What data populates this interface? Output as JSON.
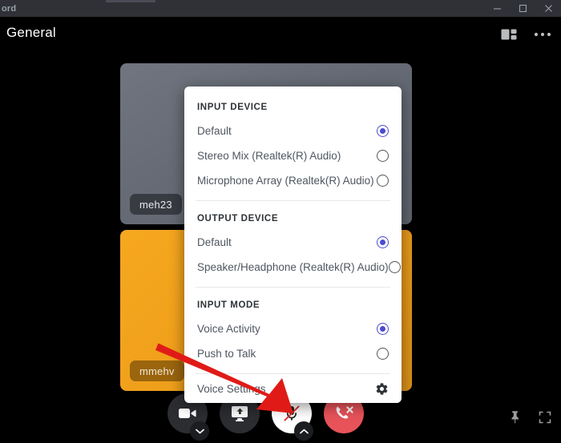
{
  "window": {
    "app_name": "ord",
    "controls": [
      {
        "name": "minimize",
        "glyph": "minimize-icon"
      },
      {
        "name": "maximize",
        "glyph": "maximize-icon"
      },
      {
        "name": "close",
        "glyph": "close-icon"
      }
    ]
  },
  "header": {
    "title": "General",
    "actions": [
      {
        "name": "layout-icon",
        "label": "Change Layout"
      },
      {
        "name": "more-icon",
        "label": "More"
      }
    ]
  },
  "stage": {
    "tiles": [
      {
        "participant": "meh23",
        "bg_color": "#656a74"
      },
      {
        "participant": "mmehv",
        "bg_color": "#f0a01b"
      }
    ]
  },
  "popup": {
    "sections": [
      {
        "title": "INPUT DEVICE",
        "rows": [
          {
            "label": "Default",
            "selected": true
          },
          {
            "label": "Stereo Mix (Realtek(R) Audio)",
            "selected": false
          },
          {
            "label": "Microphone Array (Realtek(R) Audio)",
            "selected": false
          }
        ]
      },
      {
        "title": "OUTPUT DEVICE",
        "rows": [
          {
            "label": "Default",
            "selected": true
          },
          {
            "label": "Speaker/Headphone (Realtek(R) Audio)",
            "selected": false
          }
        ]
      },
      {
        "title": "INPUT MODE",
        "rows": [
          {
            "label": "Voice Activity",
            "selected": true
          },
          {
            "label": "Push to Talk",
            "selected": false
          }
        ]
      }
    ],
    "settings_row": {
      "label": "Voice Settings",
      "icon": "gear-icon"
    },
    "accent_color": "#4b4bd0"
  },
  "controls": {
    "camera": {
      "name": "toggle-camera-button",
      "has_dropdown": true
    },
    "screen_share": {
      "name": "share-screen-button"
    },
    "microphone": {
      "name": "toggle-microphone-button",
      "muted": true,
      "has_dropdown": true
    },
    "hangup": {
      "name": "leave-call-button",
      "color": "#e8535a"
    },
    "pin": {
      "name": "pin-button"
    },
    "fullscreen": {
      "name": "fullscreen-button"
    }
  },
  "annotation": {
    "arrow_color": "#e01b17",
    "points_to": "toggle-microphone-button"
  }
}
